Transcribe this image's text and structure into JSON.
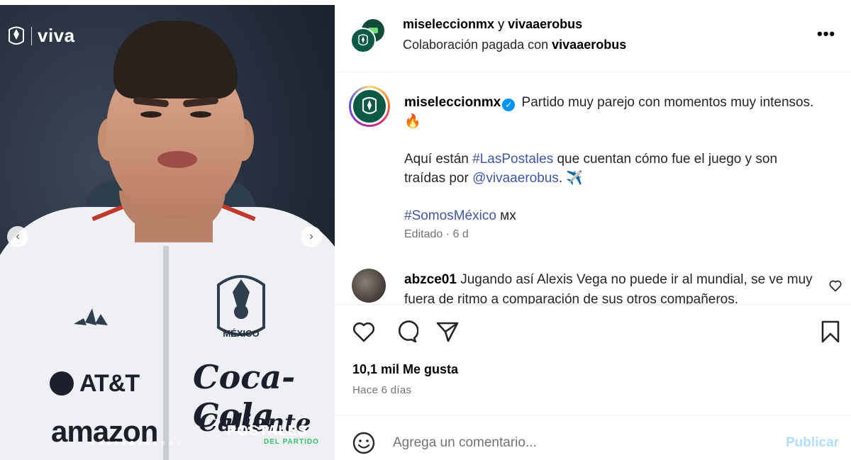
{
  "media": {
    "brand_text": "viva",
    "crest_label": "MÉXICO",
    "sponsors": {
      "att": "AT&T",
      "amazon": "amazon",
      "coca_cola": "Coca-Cola",
      "caliente": "Caliente"
    },
    "postales_title": "POSTALES",
    "postales_subtitle": "DEL PARTIDO",
    "nav_prev_icon": "chevron-left-icon",
    "nav_next_icon": "chevron-right-icon",
    "slide_count": 12,
    "active_slide": 6
  },
  "header": {
    "user1": "miseleccionmx",
    "connector": " y ",
    "user2": "vivaaerobus",
    "paid_text": "Colaboración pagada con ",
    "paid_partner": "vivaaerobus",
    "more_icon": "more-horizontal-icon"
  },
  "caption": {
    "username": "miseleccionmx",
    "line1": "Partido muy parejo con momentos muy intensos.",
    "emoji1": "🔥",
    "para2_before": "Aquí están ",
    "hashtag1": "#LasPostales",
    "para2_mid": " que cuentan cómo fue el juego y son traídas por ",
    "mention": "@vivaaerobus",
    "para2_after": ".",
    "emoji2": "✈️",
    "hashtag2": "#SomosMéxico",
    "flag": "мх",
    "edited": "Editado · 6 d"
  },
  "comment": {
    "username": "abzce01",
    "text": "Jugando así Alexis Vega no puede ir al mundial, se ve muy fuera de ritmo a comparación de sus otros compañeros."
  },
  "actions": {
    "icons": [
      "heart-icon",
      "comment-icon",
      "share-icon",
      "bookmark-icon"
    ],
    "likes": "10,1 mil Me gusta",
    "time": "Hace 6 días"
  },
  "add_comment": {
    "placeholder": "Agrega un comentario...",
    "publish": "Publicar"
  },
  "colors": {
    "link": "#3f57a8",
    "verified": "#0095f6",
    "publish_disabled": "#b2dffc",
    "brand_green": "#0d5a44"
  }
}
